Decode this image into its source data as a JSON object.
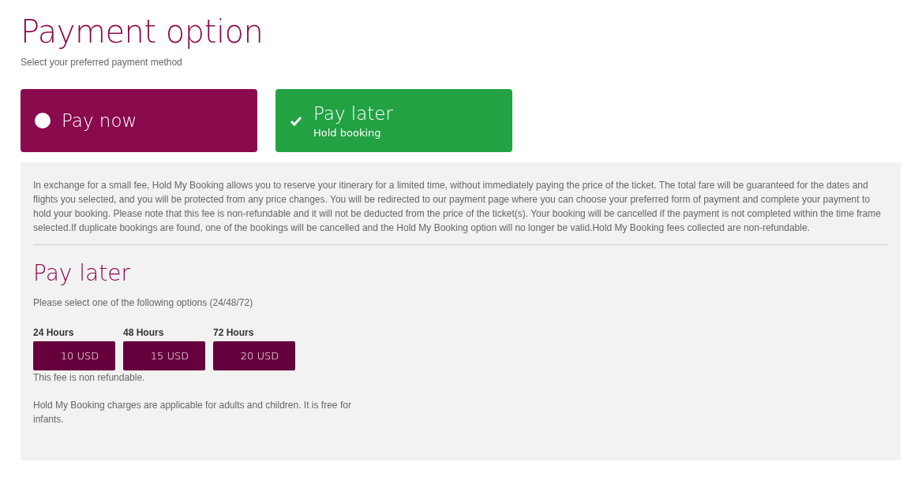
{
  "title": "Payment option",
  "subtitle": "Select your preferred payment method",
  "options": [
    {
      "label": "Pay now",
      "selected": false
    },
    {
      "label": "Pay later",
      "sublabel": "Hold booking",
      "selected": true
    }
  ],
  "panel": {
    "description": "In exchange for a small fee, Hold My Booking allows you to reserve your itinerary for a limited time, without immediately paying the price of the ticket. The total fare will be guaranteed for the dates and flights you selected, and you will be protected from any price changes. You will be redirected to our payment page where you can choose your preferred form of payment and complete your payment to hold your booking. Please note that this fee is non-refundable and it will not be deducted from the price of the ticket(s). Your booking will be cancelled if the payment is not completed within the time frame selected.If duplicate bookings are found, one of the bookings will be cancelled and the Hold My Booking option will no longer be valid.Hold My Booking fees collected are non-refundable.",
    "heading": "Pay later",
    "instruction": "Please select one of the following options (24/48/72)",
    "fees": [
      {
        "label": "24 Hours",
        "price": "10 USD"
      },
      {
        "label": "48 Hours",
        "price": "15 USD"
      },
      {
        "label": "72 Hours",
        "price": "20 USD"
      }
    ],
    "fee_note": "This fee is non refundable.",
    "charges_note": "Hold My Booking charges are applicable for adults and children. It is free for infants."
  }
}
